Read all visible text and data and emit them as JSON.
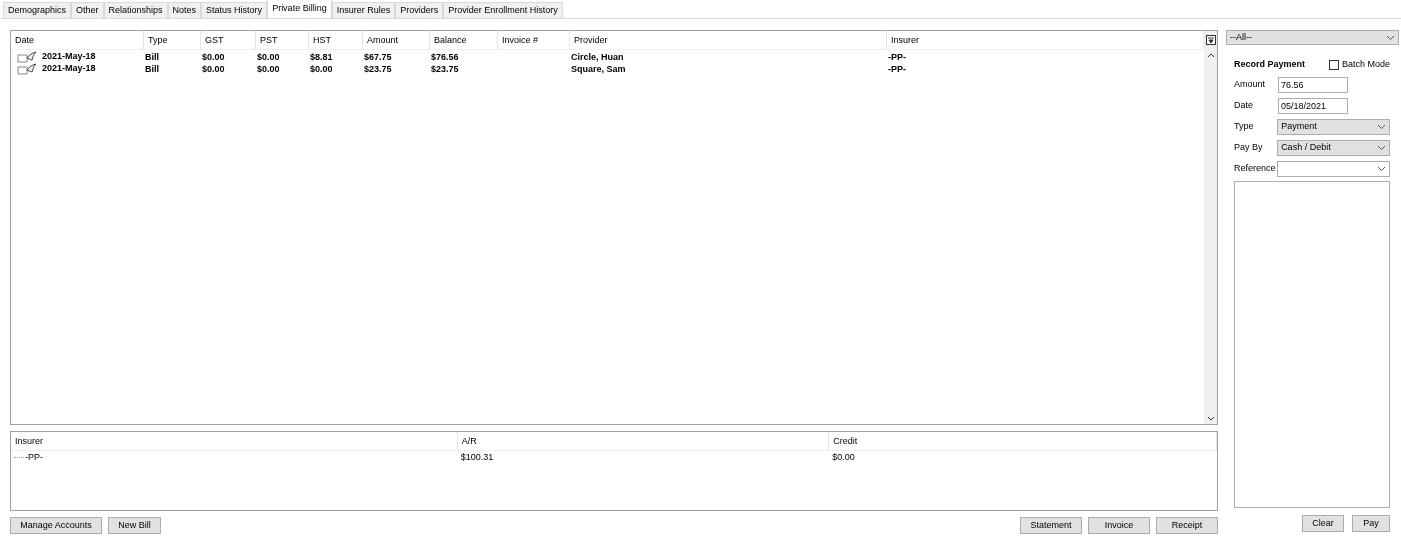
{
  "tabs": [
    {
      "label": "Demographics",
      "selected": false
    },
    {
      "label": "Other",
      "selected": false
    },
    {
      "label": "Relationships",
      "selected": false
    },
    {
      "label": "Notes",
      "selected": false
    },
    {
      "label": "Status History",
      "selected": false
    },
    {
      "label": "Private Billing",
      "selected": true
    },
    {
      "label": "Insurer Rules",
      "selected": false
    },
    {
      "label": "Providers",
      "selected": false
    },
    {
      "label": "Provider Enrollment History",
      "selected": false
    }
  ],
  "bills_table": {
    "columns": [
      "Date",
      "Type",
      "GST",
      "PST",
      "HST",
      "Amount",
      "Balance",
      "Invoice #",
      "Provider",
      "Insurer"
    ],
    "rows": [
      [
        "2021-May-18",
        "Bill",
        "$0.00",
        "$0.00",
        "$8.81",
        "$67.75",
        "$76.56",
        null,
        "Circle, Huan",
        "-PP-"
      ],
      [
        "2021-May-18",
        "Bill",
        "$0.00",
        "$0.00",
        "$0.00",
        "$23.75",
        "$23.75",
        null,
        "Square, Sam",
        "-PP-"
      ]
    ]
  },
  "accounts_table": {
    "columns": [
      "Insurer",
      "A/R",
      "Credit"
    ],
    "rows": [
      [
        "-PP-",
        "$100.31",
        "$0.00"
      ]
    ]
  },
  "left_buttons": [
    "Manage Accounts",
    "New Bill"
  ],
  "right_buttons": [
    "Statement",
    "Invoice",
    "Receipt"
  ],
  "filter": {
    "value": "--All--"
  },
  "record_payment": {
    "title": "Record Payment",
    "batch_mode": {
      "label": "Batch Mode",
      "checked": false
    },
    "fields": [
      {
        "kind": "text",
        "label": "Amount",
        "value": "76.56"
      },
      {
        "kind": "text",
        "label": "Date",
        "value": "05/18/2021"
      },
      {
        "kind": "select",
        "label": "Type",
        "value": "Payment"
      },
      {
        "kind": "select",
        "label": "Pay By",
        "value": "Cash / Debit"
      },
      {
        "kind": "combo",
        "label": "Reference"
      }
    ],
    "buttons": [
      "Clear",
      "Pay"
    ]
  }
}
